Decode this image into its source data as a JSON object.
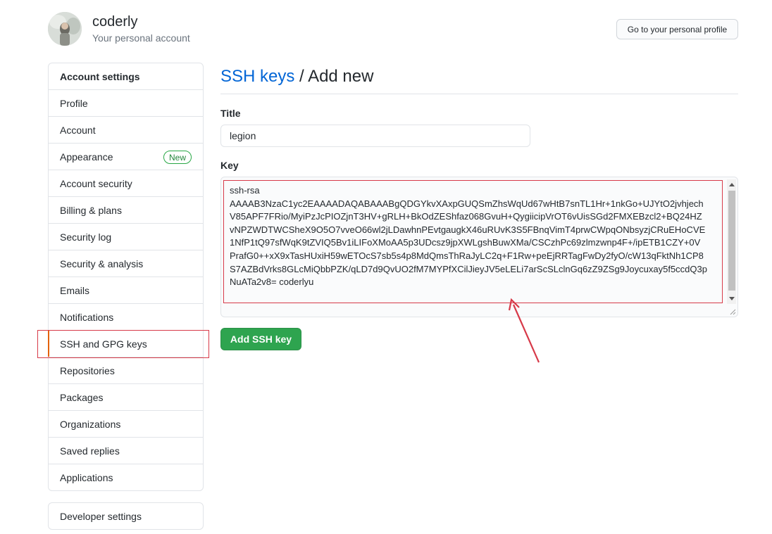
{
  "user": {
    "name": "coderly",
    "subtitle": "Your personal account",
    "profile_button": "Go to your personal profile"
  },
  "sidebar": {
    "header": "Account settings",
    "items": [
      {
        "label": "Profile"
      },
      {
        "label": "Account"
      },
      {
        "label": "Appearance",
        "badge": "New"
      },
      {
        "label": "Account security"
      },
      {
        "label": "Billing & plans"
      },
      {
        "label": "Security log"
      },
      {
        "label": "Security & analysis"
      },
      {
        "label": "Emails"
      },
      {
        "label": "Notifications"
      },
      {
        "label": "SSH and GPG keys",
        "selected": true
      },
      {
        "label": "Repositories"
      },
      {
        "label": "Packages"
      },
      {
        "label": "Organizations"
      },
      {
        "label": "Saved replies"
      },
      {
        "label": "Applications"
      }
    ],
    "developer_settings": "Developer settings"
  },
  "main": {
    "breadcrumb_link": "SSH keys",
    "breadcrumb_sep": " / ",
    "breadcrumb_current": "Add new",
    "title_label": "Title",
    "title_value": "legion",
    "key_label": "Key",
    "key_value": "ssh-rsa\nAAAAB3NzaC1yc2EAAAADAQABAAABgQDGYkvXAxpGUQSmZhsWqUd67wHtB7snTL1Hr+1nkGo+UJYtO2jvhjech\nV85APF7FRio/MyiPzJcPIOZjnT3HV+gRLH+BkOdZEShfaz068GvuH+QygiicipVrOT6vUisSGd2FMXEBzcl2+BQ24HZ\nvNPZWDTWCSheX9O5O7vveO66wl2jLDawhnPEvtgaugkX46uRUvK3S5FBnqVimT4prwCWpqONbsyzjCRuEHoCVE\n1NfP1tQ97sfWqK9tZVIQ5Bv1iLIFoXMoAA5p3UDcsz9jpXWLgshBuwXMa/CSCzhPc69zlmzwnp4F+/ipETB1CZY+0V\nPrafG0++xX9xTasHUxiH59wETOcS7sb5s4p8MdQmsThRaJyLC2q+F1Rw+peEjRRTagFwDy2fyO/cW13qFktNh1CP8\nS7AZBdVrks8GLcMiQbbPZK/qLD7d9QvUO2fM7MYPfXCilJieyJV5eLELi7arScSLclnGq6zZ9ZSg9Joycuxay5f5ccdQ3p\nNuATa2v8= coderlyu",
    "submit_label": "Add SSH key"
  },
  "colors": {
    "link": "#0366d6",
    "primary_button": "#2ea44f",
    "annotation": "#d73a49",
    "badge": "#28a745"
  }
}
